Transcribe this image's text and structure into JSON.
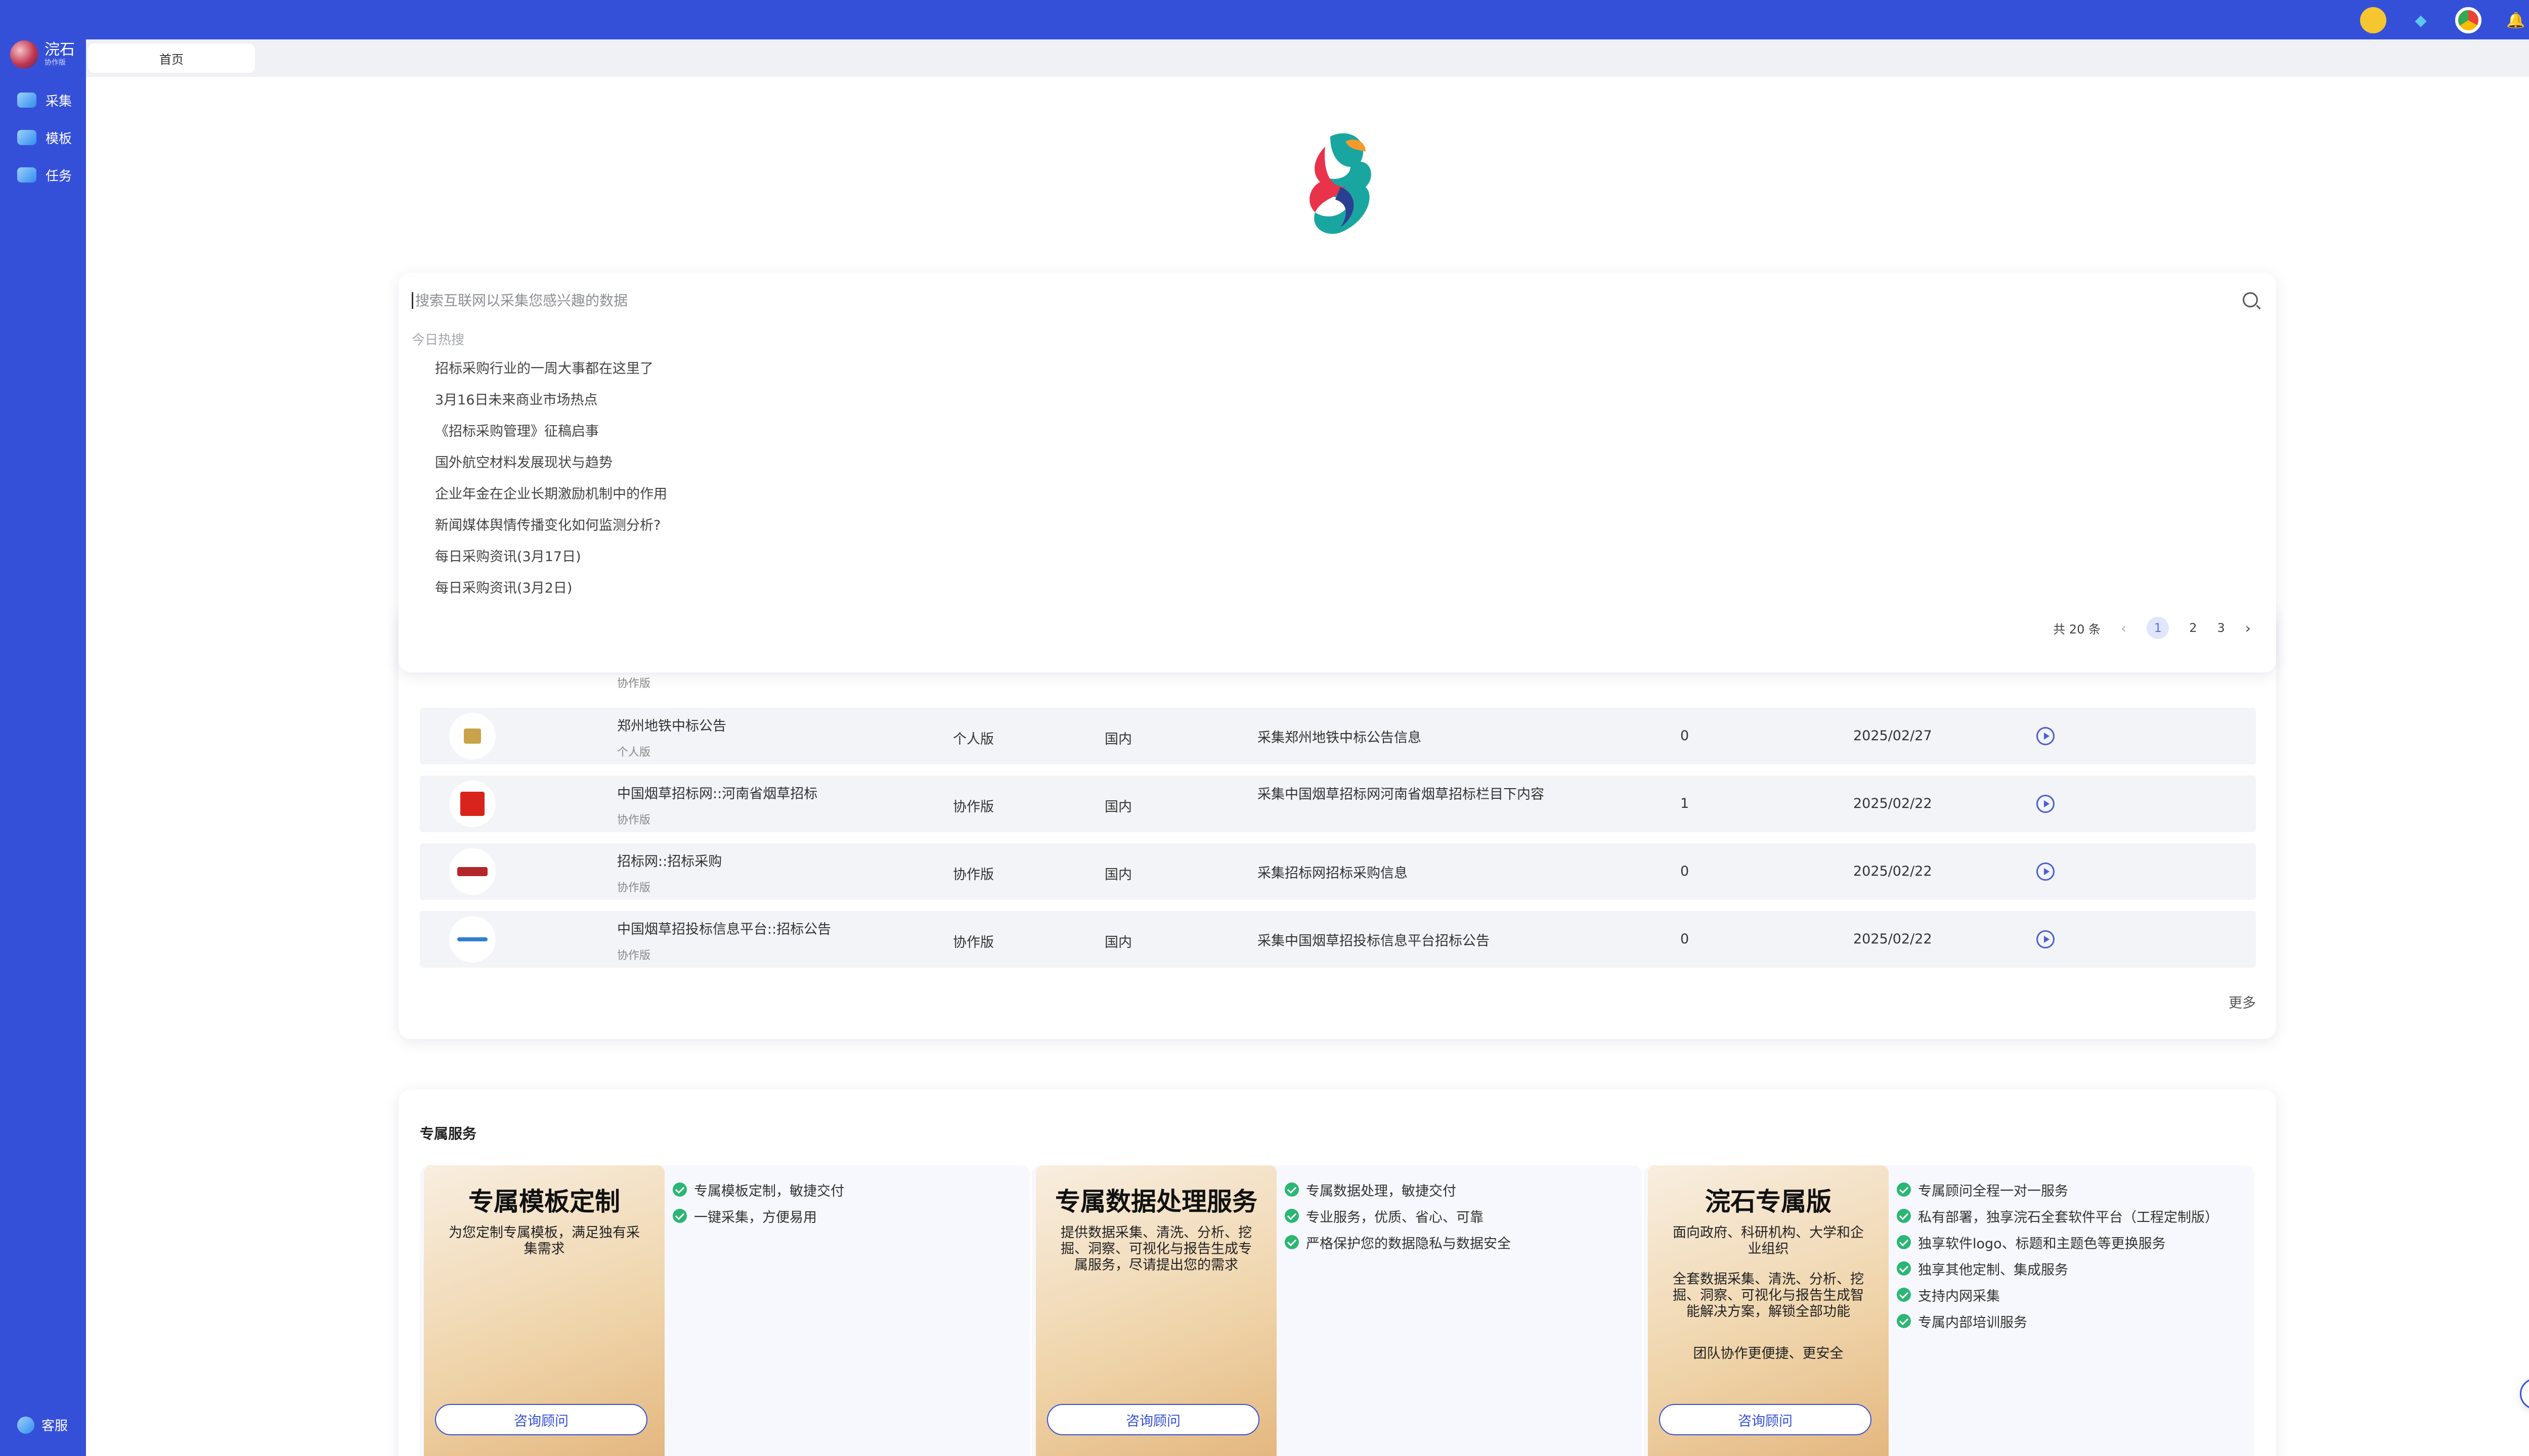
{
  "brand": {
    "name": "浣石",
    "sub": "协作版"
  },
  "sidebar": {
    "items": [
      {
        "label": "采集",
        "icon": "collect-icon"
      },
      {
        "label": "模板",
        "icon": "template-icon"
      },
      {
        "label": "任务",
        "icon": "task-icon"
      }
    ],
    "service_label": "客服"
  },
  "topbar": {
    "icons": [
      "coin-icon",
      "diamond-icon",
      "browser-icon",
      "bell-icon",
      "avatar-icon"
    ]
  },
  "tabs": [
    {
      "label": "首页"
    }
  ],
  "search": {
    "placeholder": "搜索互联网以采集您感兴趣的数据",
    "hot_title": "今日热搜",
    "hot_items": [
      "招标采购行业的一周大事都在这里了",
      "3月16日未来商业市场热点",
      "《招标采购管理》征稿启事",
      "国外航空材料发展现状与趋势",
      "企业年金在企业长期激励机制中的作用",
      "新闻媒体舆情传播变化如何监测分析?",
      "每日采购资讯(3月17日)",
      "每日采购资讯(3月2日)"
    ],
    "pager": {
      "total": "共 20 条",
      "pages": [
        "1",
        "2",
        "3"
      ],
      "active": "1"
    }
  },
  "table": {
    "ghost_edition": "协作版",
    "rows": [
      {
        "name": "郑州地铁中标公告",
        "edition": "个人版",
        "region": "国内",
        "desc": "采集郑州地铁中标公告信息",
        "count": "0",
        "date": "2025/02/27",
        "logo_color": "#c9a24a"
      },
      {
        "name": "中国烟草招标网::河南省烟草招标",
        "edition": "协作版",
        "region": "国内",
        "desc": "采集中国烟草招标网河南省烟草招标栏目下内容",
        "count": "1",
        "date": "2025/02/22",
        "logo_color": "#d9241c"
      },
      {
        "name": "招标网::招标采购",
        "edition": "协作版",
        "region": "国内",
        "desc": "采集招标网招标采购信息",
        "count": "0",
        "date": "2025/02/22",
        "logo_color": "#b3262a"
      },
      {
        "name": "中国烟草招投标信息平台::招标公告",
        "edition": "协作版",
        "region": "国内",
        "desc": "采集中国烟草招投标信息平台招标公告",
        "count": "0",
        "date": "2025/02/22",
        "logo_color": "#2f7fd0"
      }
    ],
    "more_label": "更多"
  },
  "services": {
    "title": "专属服务",
    "cards": [
      {
        "title": "专属模板定制",
        "desc": "为您定制专属模板，满足独有采集需求",
        "desc2": "",
        "desc3": "",
        "button": "咨询顾问",
        "features": [
          "专属模板定制，敏捷交付",
          "一键采集，方便易用"
        ]
      },
      {
        "title": "专属数据处理服务",
        "desc": "提供数据采集、清洗、分析、挖掘、洞察、可视化与报告生成专属服务，尽请提出您的需求",
        "desc2": "",
        "desc3": "",
        "button": "咨询顾问",
        "features": [
          "专属数据处理，敏捷交付",
          "专业服务，优质、省心、可靠",
          "严格保护您的数据隐私与数据安全"
        ]
      },
      {
        "title": "浣石专属版",
        "desc": "面向政府、科研机构、大学和企业组织",
        "desc2": "全套数据采集、清洗、分析、挖掘、洞察、可视化与报告生成智能解决方案，解锁全部功能",
        "desc3": "团队协作更便捷、更安全",
        "button": "咨询顾问",
        "features": [
          "专属顾问全程一对一服务",
          "私有部署，独享浣石全套软件平台（工程定制版）",
          "独享软件logo、标题和主题色等更换服务",
          "独享其他定制、集成服务",
          "支持内网采集",
          "专属内部培训服务"
        ]
      }
    ]
  },
  "colors": {
    "primary": "#3550d8",
    "check": "#2bb673"
  }
}
